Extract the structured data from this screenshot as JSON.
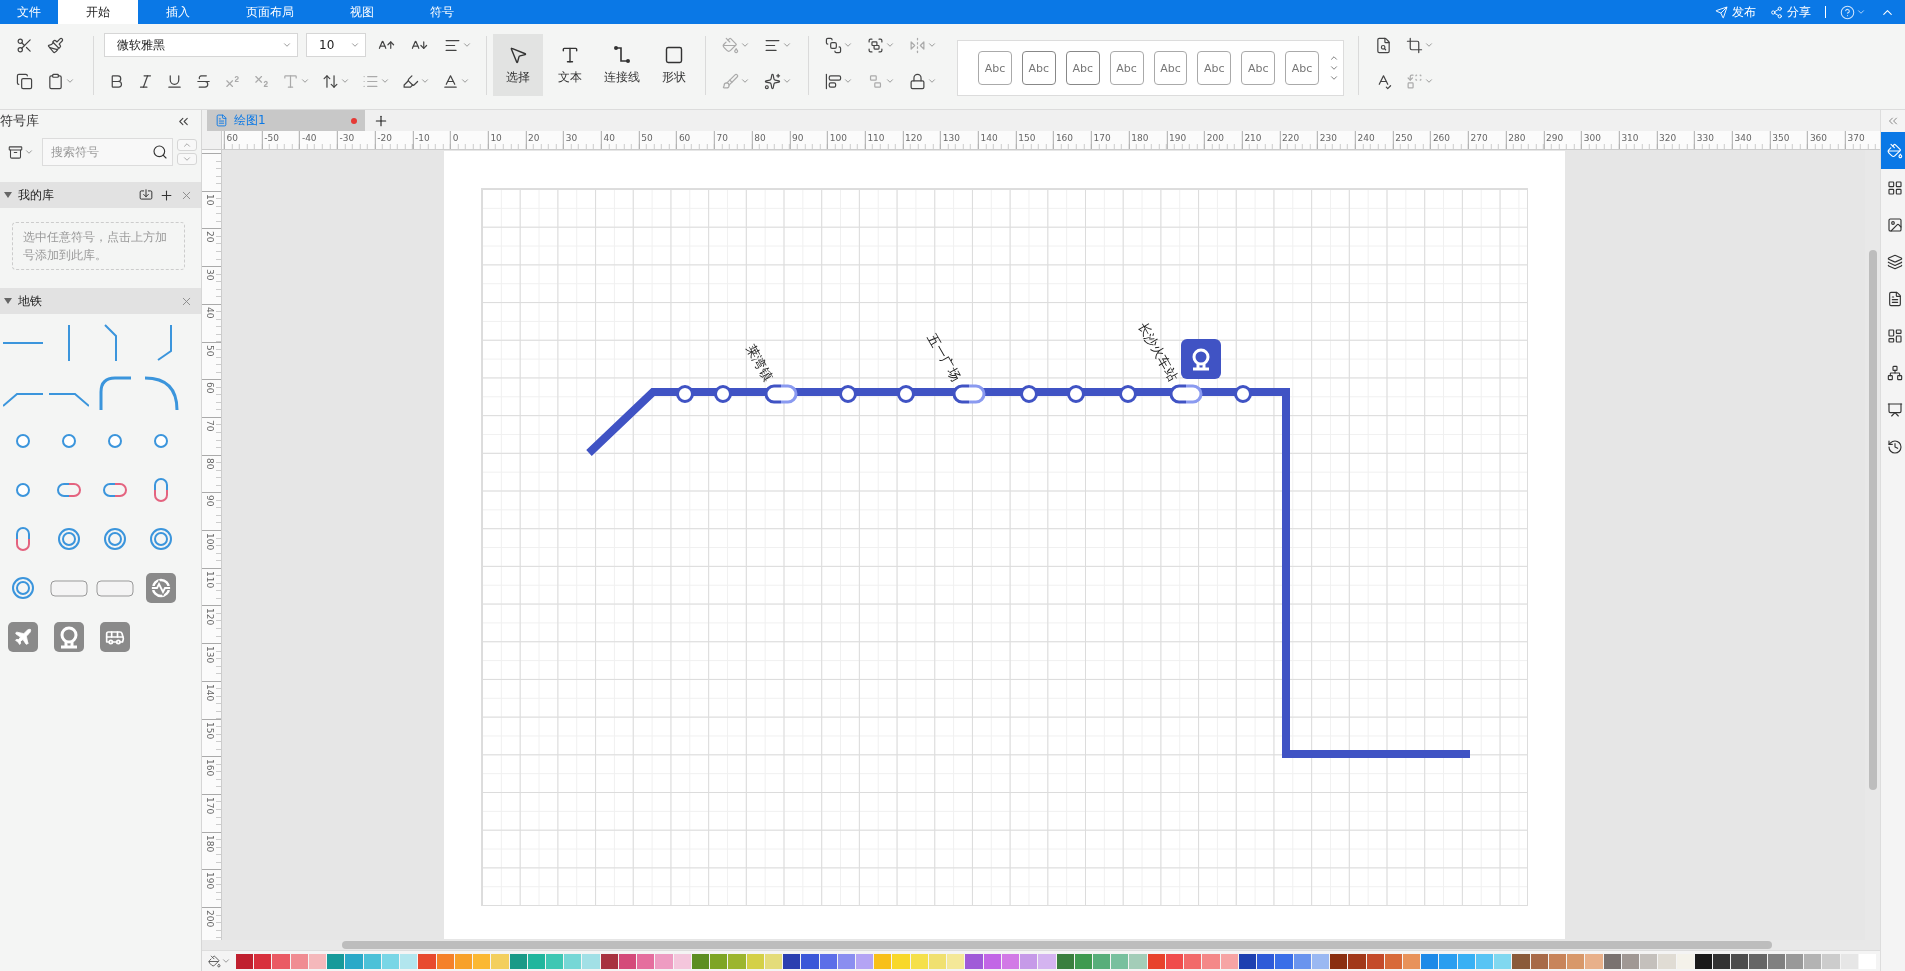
{
  "menu_tabs": [
    {
      "label": "文件",
      "selected": false
    },
    {
      "label": "开始",
      "selected": true
    },
    {
      "label": "插入",
      "selected": false
    },
    {
      "label": "页面布局",
      "selected": false
    },
    {
      "label": "视图",
      "selected": false
    },
    {
      "label": "符号",
      "selected": false
    }
  ],
  "header_actions": [
    "发布",
    "分享"
  ],
  "toolbar": {
    "font": "微软雅黑",
    "font_size": "10",
    "tools": [
      {
        "label": "选择",
        "selected": true
      },
      {
        "label": "文本",
        "selected": false
      },
      {
        "label": "连接线",
        "selected": false
      },
      {
        "label": "形状",
        "selected": false
      }
    ],
    "style_presets": [
      "Abc",
      "Abc",
      "Abc",
      "Abc",
      "Abc",
      "Abc",
      "Abc",
      "Abc"
    ]
  },
  "library": {
    "title": "符号库",
    "search_placeholder": "搜索符号",
    "sections": [
      {
        "title": "我的库",
        "expanded": true,
        "hint": "选中任意符号，点击上方加号添加到此库。"
      },
      {
        "title": "地铁",
        "expanded": true
      }
    ]
  },
  "document_tabs": [
    {
      "label": "绘图1",
      "selected": true,
      "modified": true
    }
  ],
  "ruler": {
    "x_labels": [
      "60",
      "-50",
      "-40",
      "-30",
      "-20",
      "-10",
      "0",
      "10",
      "20",
      "30",
      "40",
      "50",
      "60",
      "70",
      "80",
      "90",
      "100",
      "110",
      "120",
      "130",
      "140",
      "150",
      "160",
      "170",
      "180",
      "190",
      "200",
      "210",
      "220",
      "230",
      "240",
      "250",
      "260",
      "270",
      "280",
      "290",
      "300",
      "310",
      "320",
      "330",
      "340",
      "350",
      "360",
      "370"
    ],
    "y_labels": [
      "10",
      "20",
      "30",
      "40",
      "50",
      "60",
      "70",
      "80",
      "90",
      "100",
      "110",
      "120",
      "130",
      "140",
      "150",
      "160",
      "170",
      "180",
      "190",
      "200"
    ]
  },
  "diagram": {
    "stations": [
      {
        "kind": "stop"
      },
      {
        "kind": "stop"
      },
      {
        "kind": "transfer",
        "label": "莱湾镇"
      },
      {
        "kind": "stop"
      },
      {
        "kind": "stop"
      },
      {
        "kind": "transfer",
        "label": "五一广场"
      },
      {
        "kind": "stop"
      },
      {
        "kind": "stop"
      },
      {
        "kind": "stop"
      },
      {
        "kind": "transfer",
        "label": "长沙火车站",
        "rail_icon": true
      },
      {
        "kind": "stop"
      }
    ]
  },
  "right_panel": [
    {
      "selected": true
    },
    {
      "selected": false
    },
    {
      "selected": false
    },
    {
      "selected": false
    },
    {
      "selected": false
    },
    {
      "selected": false
    },
    {
      "selected": false
    },
    {
      "selected": false
    },
    {
      "selected": false
    }
  ],
  "palette": [
    {
      "color": "#c0202f"
    },
    {
      "color": "#d8303d"
    },
    {
      "color": "#ea5a64"
    },
    {
      "color": "#f08c92"
    },
    {
      "color": "#f5b8bb"
    },
    {
      "color": "#169a9a"
    },
    {
      "color": "#2aa9c8"
    },
    {
      "color": "#4cc1d8"
    },
    {
      "color": "#79d6e6"
    },
    {
      "color": "#b2e6ee"
    },
    {
      "color": "#e84a2f"
    },
    {
      "color": "#f5812a"
    },
    {
      "color": "#f8a12a"
    },
    {
      "color": "#fbb833"
    },
    {
      "color": "#f3cf5e"
    },
    {
      "color": "#1a9a87"
    },
    {
      "color": "#21b69d"
    },
    {
      "color": "#3ec7b3"
    },
    {
      "color": "#76d7d6"
    },
    {
      "color": "#a2e0e6"
    },
    {
      "color": "#a83240"
    },
    {
      "color": "#d44a7a"
    },
    {
      "color": "#e56e9e"
    },
    {
      "color": "#ee9cc2"
    },
    {
      "color": "#f4c6dc"
    },
    {
      "color": "#5d8e22"
    },
    {
      "color": "#7ea525"
    },
    {
      "color": "#9cb52e"
    },
    {
      "color": "#d4d047"
    },
    {
      "color": "#e4dc7a"
    },
    {
      "color": "#2b3fb0"
    },
    {
      "color": "#3b57d8"
    },
    {
      "color": "#5c6ee8"
    },
    {
      "color": "#8a8ef0"
    },
    {
      "color": "#b4a4f4"
    },
    {
      "color": "#f8c01a"
    },
    {
      "color": "#f8d82a"
    },
    {
      "color": "#f5e04a"
    },
    {
      "color": "#f0e070"
    },
    {
      "color": "#f4e898"
    },
    {
      "color": "#a05ad8"
    },
    {
      "color": "#c266e6"
    },
    {
      "color": "#d27ae6"
    },
    {
      "color": "#c69ae8"
    },
    {
      "color": "#d4b4f0"
    },
    {
      "color": "#3a7f3e"
    },
    {
      "color": "#3f9a50"
    },
    {
      "color": "#58ae7a"
    },
    {
      "color": "#78c09e"
    },
    {
      "color": "#a3cdb8"
    },
    {
      "color": "#e8422c"
    },
    {
      "color": "#f04c4c"
    },
    {
      "color": "#f26a6a"
    },
    {
      "color": "#f48888"
    },
    {
      "color": "#f6a4a4"
    },
    {
      "color": "#1e40b0"
    },
    {
      "color": "#2e5ad8"
    },
    {
      "color": "#3a6ee8"
    },
    {
      "color": "#6a94ee"
    },
    {
      "color": "#9ab8f2"
    },
    {
      "color": "#8a2e10"
    },
    {
      "color": "#a2381a"
    },
    {
      "color": "#c44a2a"
    },
    {
      "color": "#d86a3a"
    },
    {
      "color": "#e8925a"
    },
    {
      "color": "#1e8ae8"
    },
    {
      "color": "#2a9ef0"
    },
    {
      "color": "#38b0f4"
    },
    {
      "color": "#58c4f4"
    },
    {
      "color": "#80d8f0"
    },
    {
      "color": "#8a5a3a"
    },
    {
      "color": "#a86a48"
    },
    {
      "color": "#c8845a"
    },
    {
      "color": "#d8986a"
    },
    {
      "color": "#e8b08a"
    },
    {
      "color": "#7a7270"
    },
    {
      "color": "#a09894"
    },
    {
      "color": "#c4c0bc"
    },
    {
      "color": "#e0dcd4"
    },
    {
      "color": "#f4f2ea"
    },
    {
      "color": "#1a1a1a"
    },
    {
      "color": "#333333"
    },
    {
      "color": "#4d4d4d"
    },
    {
      "color": "#666666"
    },
    {
      "color": "#808080"
    },
    {
      "color": "#999999"
    },
    {
      "color": "#b3b3b3"
    },
    {
      "color": "#cccccc"
    },
    {
      "color": "#e6e6e6"
    },
    {
      "color": "#ffffff"
    }
  ]
}
